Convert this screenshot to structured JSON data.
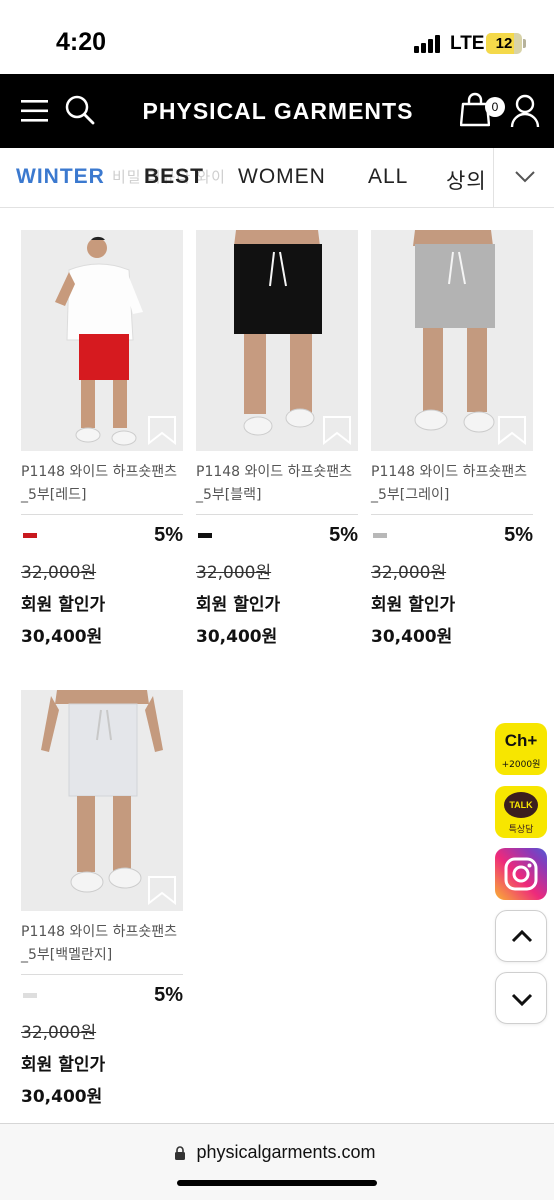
{
  "status_bar": {
    "time": "4:20",
    "network": "LTE",
    "battery": "12"
  },
  "header": {
    "brand": "PHYSICAL GARMENTS",
    "cart_count": "0",
    "icons": [
      "menu-icon",
      "search-icon",
      "cart-icon",
      "user-icon"
    ]
  },
  "category_nav": {
    "items": [
      {
        "label": "WINTER",
        "active": true
      },
      {
        "label": "BEST",
        "active": false
      },
      {
        "label": "WOMEN",
        "active": false
      },
      {
        "label": "ALL",
        "active": false
      },
      {
        "label": "상의",
        "active": false
      }
    ],
    "ghost_text": "비밀    러규다           와이",
    "toggle_icon": "chevron-down-icon",
    "accent_color": "#3b79cf"
  },
  "products": [
    {
      "name": "P1148 와이드 하프숏팬츠_5부[레드]",
      "swatch_color": "#c8191e",
      "discount": "5%",
      "original_price": "32,000원",
      "member_label": "회원 할인가",
      "sale_price": "30,400원"
    },
    {
      "name": "P1148 와이드 하프숏팬츠_5부[블랙]",
      "swatch_color": "#111111",
      "discount": "5%",
      "original_price": "32,000원",
      "member_label": "회원 할인가",
      "sale_price": "30,400원"
    },
    {
      "name": "P1148 와이드 하프숏팬츠_5부[그레이]",
      "swatch_color": "#b8b8b8",
      "discount": "5%",
      "original_price": "32,000원",
      "member_label": "회원 할인가",
      "sale_price": "30,400원"
    },
    {
      "name": "P1148 와이드 하프숏팬츠_5부[백멜란지]",
      "swatch_color": "#dedede",
      "discount": "5%",
      "original_price": "32,000원",
      "member_label": "회원 할인가",
      "sale_price": "30,400원"
    }
  ],
  "floating": {
    "channel_label": "Ch+",
    "channel_sub": "+2000원",
    "talk_label": "TALK",
    "talk_sub": "특상담",
    "instagram_icon": "instagram-icon",
    "up_icon": "chevron-up-icon",
    "down_icon": "chevron-down-icon"
  },
  "url_bar": {
    "url": "physicalgarments.com",
    "lock_icon": "lock-icon"
  }
}
